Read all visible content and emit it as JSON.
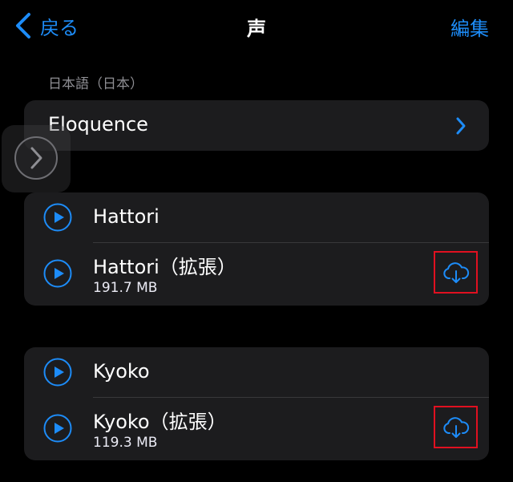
{
  "nav": {
    "back_label": "戻る",
    "title": "声",
    "edit_label": "編集"
  },
  "section": {
    "header": "日本語（日本）"
  },
  "eloquence": {
    "label": "Eloquence"
  },
  "hattori": {
    "default_name": "Hattori",
    "enhanced_name": "Hattori（拡張）",
    "enhanced_size": "191.7 MB"
  },
  "kyoko": {
    "default_name": "Kyoko",
    "enhanced_name": "Kyoko（拡張）",
    "enhanced_size": "119.3 MB"
  },
  "colors": {
    "accent": "#1d8cf8",
    "background": "#000000",
    "card": "#1c1c1e",
    "highlight": "#e01020"
  }
}
